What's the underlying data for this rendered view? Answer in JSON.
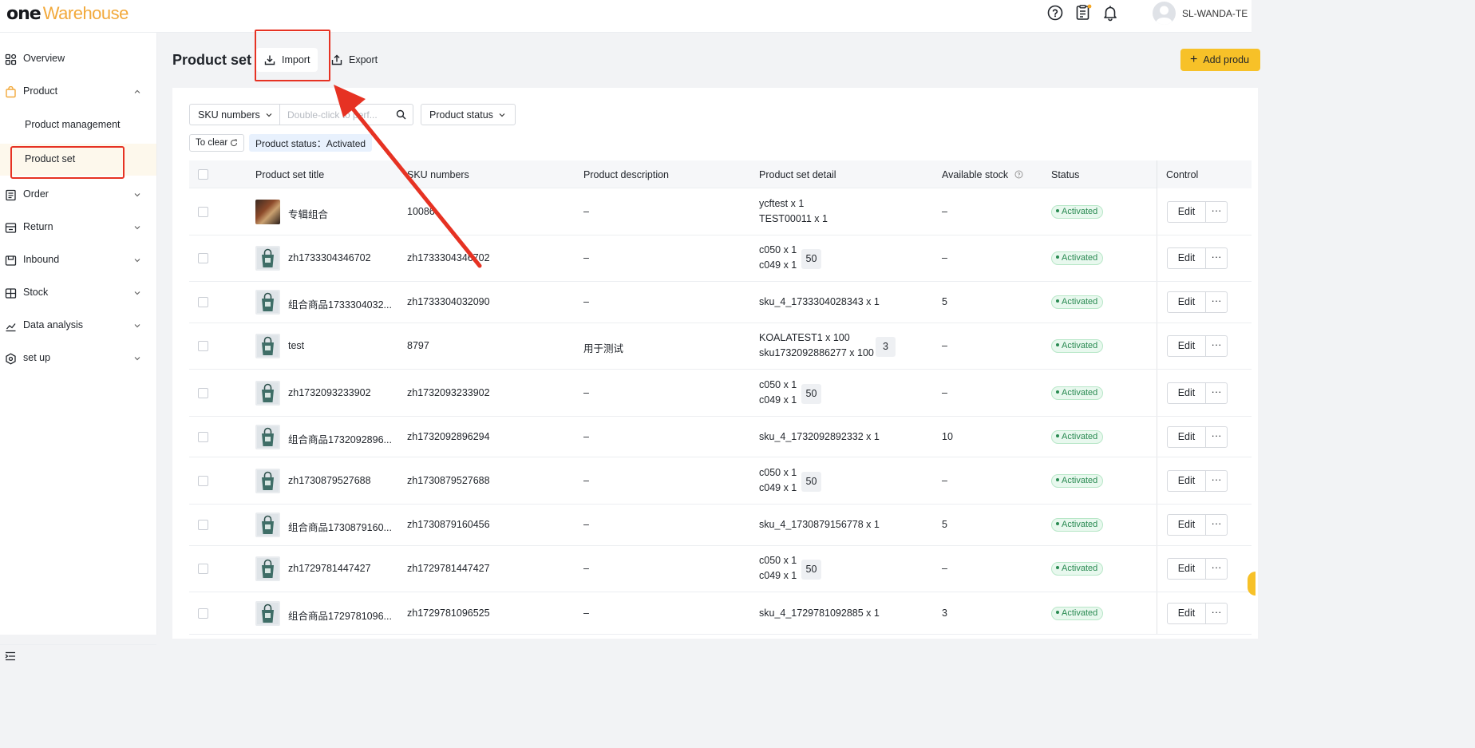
{
  "header": {
    "logo_one": "one",
    "logo_rest": "Warehouse",
    "username": "SL-WANDA-TE",
    "icons": [
      "help-circle-icon",
      "clipboard-icon",
      "bell-icon"
    ]
  },
  "sidebar": {
    "items": [
      {
        "label": "Overview",
        "icon": "grid-icon"
      },
      {
        "label": "Product",
        "icon": "bag-icon",
        "expanded": true,
        "children": [
          {
            "label": "Product management"
          },
          {
            "label": "Product set",
            "active": true
          }
        ]
      },
      {
        "label": "Order",
        "icon": "list-icon"
      },
      {
        "label": "Return",
        "icon": "return-icon"
      },
      {
        "label": "Inbound",
        "icon": "inbound-icon"
      },
      {
        "label": "Stock",
        "icon": "stock-icon"
      },
      {
        "label": "Data analysis",
        "icon": "chart-icon"
      },
      {
        "label": "set up",
        "icon": "settings-icon"
      }
    ]
  },
  "page": {
    "title": "Product set",
    "import_label": "Import",
    "export_label": "Export",
    "add_label": "Add produ"
  },
  "filters": {
    "sku_select": "SKU numbers",
    "search_placeholder": "Double-click to perf...",
    "status_select": "Product status",
    "to_clear": "To clear",
    "chip": "Product status：Activated"
  },
  "table": {
    "headers": {
      "title": "Product set title",
      "sku": "SKU numbers",
      "desc": "Product description",
      "detail": "Product set detail",
      "stock": "Available stock",
      "status": "Status",
      "control": "Control"
    },
    "edit_label": "Edit",
    "more_label": "···",
    "rows": [
      {
        "title": "专辑组合",
        "sku": "10086",
        "desc": "–",
        "detail": [
          "ycftest x 1",
          "TEST00011 x 1"
        ],
        "badge": "",
        "stock": "–",
        "status": "Activated",
        "thumb": "album"
      },
      {
        "title": "zh1733304346702",
        "sku": "zh1733304346702",
        "desc": "–",
        "detail": [
          "c050 x 1",
          "c049 x 1"
        ],
        "badge": "50",
        "stock": "–",
        "status": "Activated",
        "thumb": "bag"
      },
      {
        "title": "组合商品1733304032...",
        "sku": "zh1733304032090",
        "desc": "–",
        "detail": [
          "sku_4_1733304028343 x 1"
        ],
        "badge": "",
        "stock": "5",
        "status": "Activated",
        "thumb": "bag"
      },
      {
        "title": "test",
        "sku": "8797",
        "desc": "用于测试",
        "detail": [
          "KOALATEST1 x 100",
          "sku1732092886277 x 100"
        ],
        "badge": "3",
        "stock": "–",
        "status": "Activated",
        "thumb": "bag"
      },
      {
        "title": "zh1732093233902",
        "sku": "zh1732093233902",
        "desc": "–",
        "detail": [
          "c050 x 1",
          "c049 x 1"
        ],
        "badge": "50",
        "stock": "–",
        "status": "Activated",
        "thumb": "bag"
      },
      {
        "title": "组合商品1732092896...",
        "sku": "zh1732092896294",
        "desc": "–",
        "detail": [
          "sku_4_1732092892332 x 1"
        ],
        "badge": "",
        "stock": "10",
        "status": "Activated",
        "thumb": "bag"
      },
      {
        "title": "zh1730879527688",
        "sku": "zh1730879527688",
        "desc": "–",
        "detail": [
          "c050 x 1",
          "c049 x 1"
        ],
        "badge": "50",
        "stock": "–",
        "status": "Activated",
        "thumb": "bag"
      },
      {
        "title": "组合商品1730879160...",
        "sku": "zh1730879160456",
        "desc": "–",
        "detail": [
          "sku_4_1730879156778 x 1"
        ],
        "badge": "",
        "stock": "5",
        "status": "Activated",
        "thumb": "bag"
      },
      {
        "title": "zh1729781447427",
        "sku": "zh1729781447427",
        "desc": "–",
        "detail": [
          "c050 x 1",
          "c049 x 1"
        ],
        "badge": "50",
        "stock": "–",
        "status": "Activated",
        "thumb": "bag"
      },
      {
        "title": "组合商品1729781096...",
        "sku": "zh1729781096525",
        "desc": "–",
        "detail": [
          "sku_4_1729781092885 x 1"
        ],
        "badge": "",
        "stock": "3",
        "status": "Activated",
        "thumb": "bag"
      }
    ]
  },
  "colors": {
    "accent": "#f7c128",
    "annotation_red": "#e63223",
    "status_green": "#2a8a52"
  }
}
